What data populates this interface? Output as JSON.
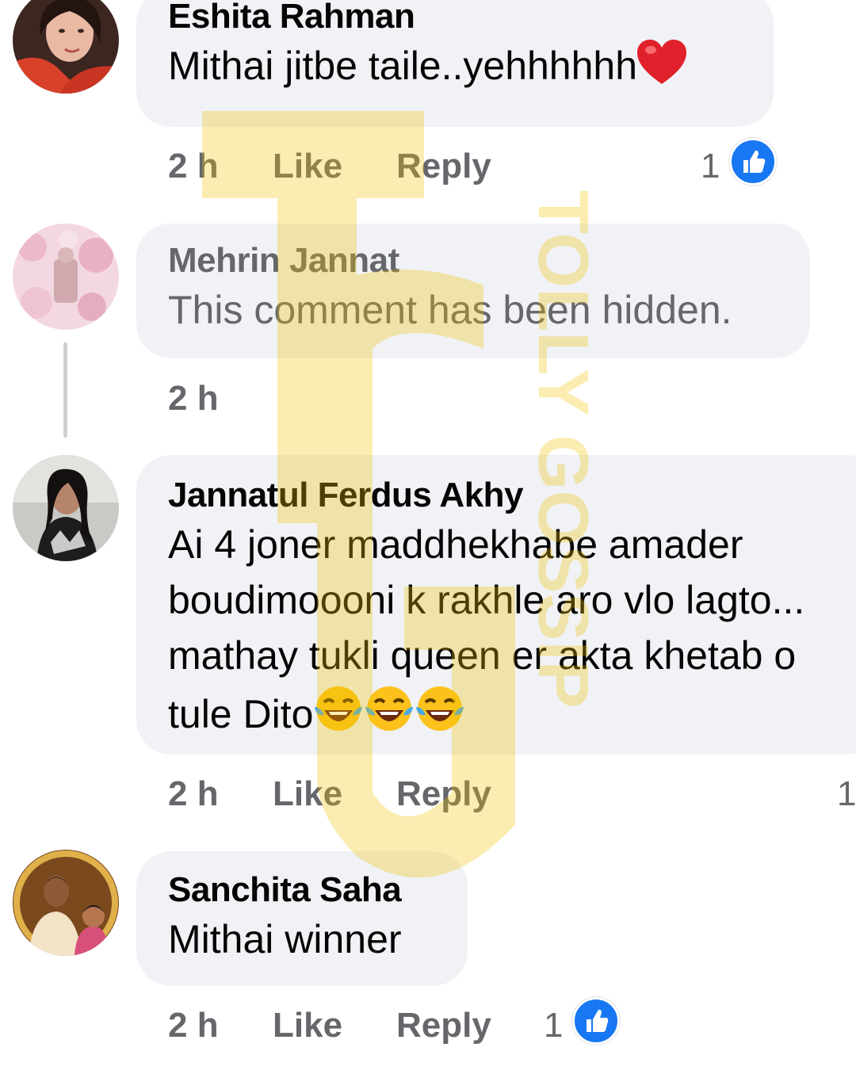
{
  "comments": [
    {
      "author": "Eshita Rahman",
      "lines": [
        "Mithai jitbe taile..yehhhhhh"
      ],
      "emoji_suffix": "heart",
      "time": "2 h",
      "like_label": "Like",
      "reply_label": "Reply",
      "reaction_count": "1"
    },
    {
      "author": "Mehrin Jannat",
      "lines": [
        "This comment has been hidden."
      ],
      "time": "2 h"
    },
    {
      "author": "Jannatul Ferdus Akhy",
      "lines": [
        "Ai 4 joner maddhekhabe amader",
        "boudimoooni k rakhle aro vlo lagto...",
        "mathay tukli queen er akta khetab o",
        "tule Dito"
      ],
      "emoji_suffix": "laughing-tears x3",
      "time": "2 h",
      "like_label": "Like",
      "reply_label": "Reply",
      "reaction_count": "1"
    },
    {
      "author": "Sanchita Saha",
      "lines": [
        "Mithai winner"
      ],
      "time": "2 h",
      "like_label": "Like",
      "reply_label": "Reply",
      "reaction_count": "1"
    }
  ],
  "watermark": {
    "text": "TOLLY GOSSIP",
    "color": "#f2c200"
  },
  "colors": {
    "bubble": "#f0f2f5",
    "secondary_text": "#65676b",
    "like_blue": "#1877f2"
  },
  "icons": [
    "like-reaction-icon",
    "heart-emoji-icon",
    "laughing-tears-emoji-icon"
  ]
}
